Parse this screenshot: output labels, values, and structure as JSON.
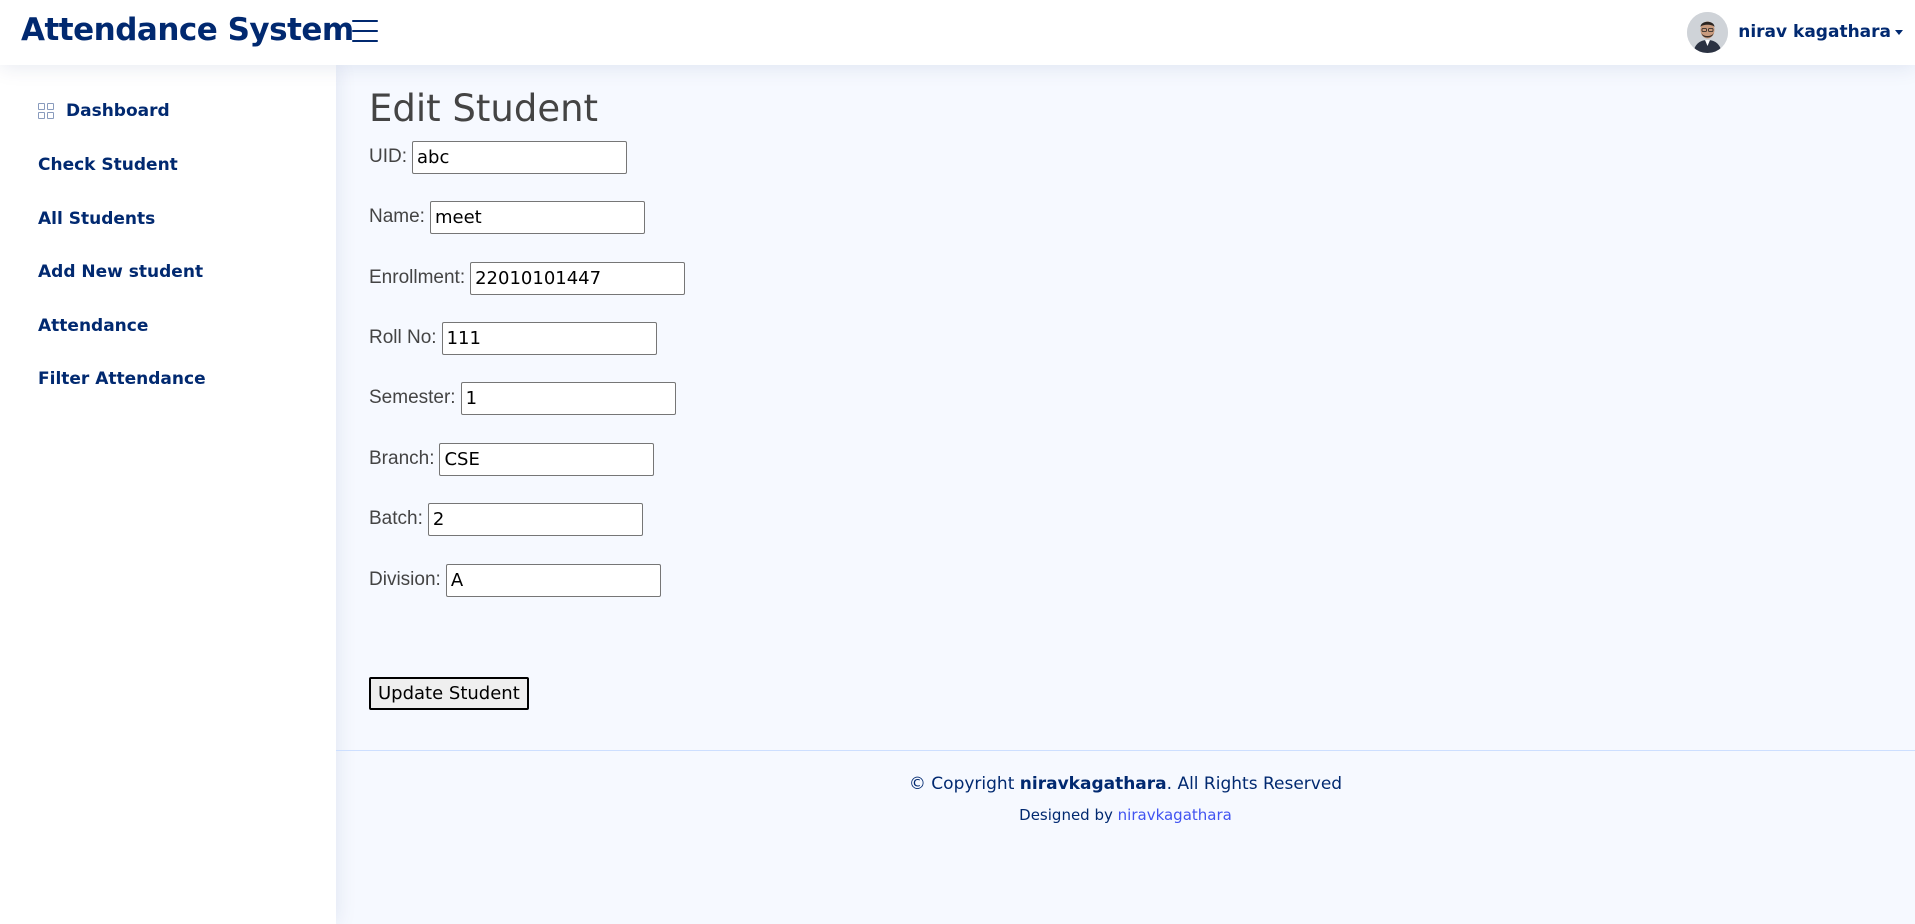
{
  "header": {
    "logo": "Attendance System",
    "user_name": "nirav kagathara"
  },
  "sidebar": {
    "items": [
      {
        "label": "Dashboard",
        "icon": "grid-icon"
      },
      {
        "label": "Check Student"
      },
      {
        "label": "All Students"
      },
      {
        "label": "Add New student"
      },
      {
        "label": "Attendance"
      },
      {
        "label": "Filter Attendance"
      }
    ]
  },
  "main": {
    "title": "Edit Student",
    "fields": [
      {
        "label": "UID:",
        "value": "abc"
      },
      {
        "label": "Name:",
        "value": "meet"
      },
      {
        "label": "Enrollment:",
        "value": "22010101447"
      },
      {
        "label": "Roll No:",
        "value": "111"
      },
      {
        "label": "Semester:",
        "value": "1"
      },
      {
        "label": "Branch:",
        "value": "CSE"
      },
      {
        "label": "Batch:",
        "value": "2"
      },
      {
        "label": "Division:",
        "value": "A"
      }
    ],
    "submit_label": "Update Student"
  },
  "footer": {
    "copyright_prefix": "© Copyright",
    "copyright_owner": "niravkagathara",
    "copyright_suffix": ". All Rights Reserved",
    "designed_by_prefix": "Designed by",
    "designed_by_link": "niravkagathara"
  },
  "colors": {
    "primary": "#012970",
    "link": "#4154f1",
    "background": "#f6f9ff"
  }
}
